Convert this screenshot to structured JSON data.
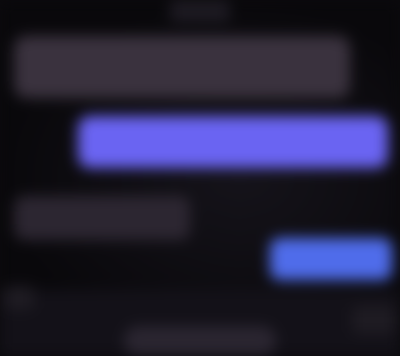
{
  "chat": {
    "header": {},
    "messages": [
      {
        "direction": "incoming",
        "text": ""
      },
      {
        "direction": "outgoing",
        "text": ""
      },
      {
        "direction": "incoming",
        "text": ""
      },
      {
        "direction": "outgoing",
        "text": ""
      }
    ],
    "composer": {
      "placeholder": ""
    }
  },
  "colors": {
    "background": "#0b0a0d",
    "incoming_bubble": "#3a323e",
    "incoming_bubble_dim": "#2c2631",
    "outgoing_bubble_accent": "#6a64f2",
    "outgoing_bubble_blue": "#4f6cea",
    "composer_bar": "#131118"
  }
}
